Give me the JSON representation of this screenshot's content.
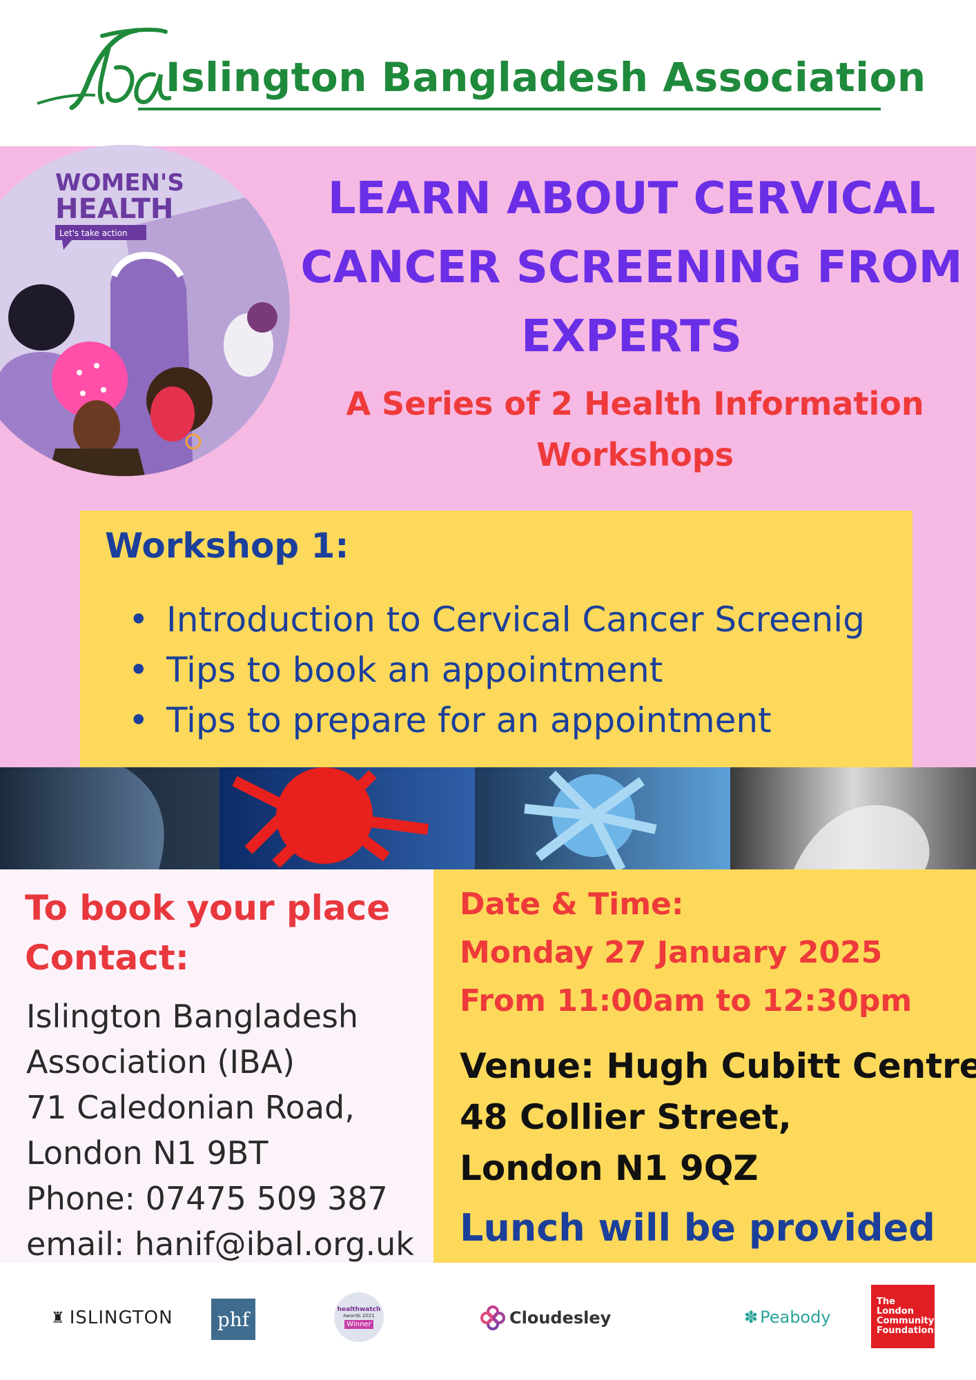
{
  "header": {
    "org_name": "Islington Bangladesh Association",
    "brand_color": "#1f8a3b"
  },
  "hero": {
    "image_text_line1": "WOMEN'S",
    "image_text_line2": "HEALTH",
    "image_tagline": "Let's take action",
    "headline_lines": [
      "LEARN ABOUT CERVICAL",
      "CANCER SCREENING FROM",
      "EXPERTS"
    ],
    "subheading_lines": [
      "A Series of 2 Health Information",
      "Workshops"
    ]
  },
  "workshop": {
    "title": "Workshop 1:",
    "items": [
      "Introduction to Cervical Cancer Screenig",
      "Tips to book an appointment",
      "Tips to prepare for an appointment"
    ]
  },
  "contact": {
    "heading_lines": [
      "To book your place",
      "Contact:"
    ],
    "lines": [
      "Islington Bangladesh",
      "Association (IBA)",
      "71 Caledonian Road,",
      "London  N1 9BT",
      "Phone: 07475 509 387",
      "email: hanif@ibal.org.uk"
    ]
  },
  "event": {
    "datetime_lines": [
      "Date & Time:",
      "Monday 27 January 2025",
      "From 11:00am to 12:30pm"
    ],
    "venue_lines": [
      "Venue: Hugh Cubitt Centre",
      "48 Collier Street,",
      "London N1 9QZ"
    ],
    "lunch": "Lunch will be provided"
  },
  "sponsors": {
    "islington": "ISLINGTON",
    "phf": "phf",
    "healthwatch": "healthwatch",
    "healthwatch_award": "Awards 2021",
    "healthwatch_winner": "Winner",
    "cloudesley": "Cloudesley",
    "peabody": "Peabody",
    "tlcf_lines": [
      "The London",
      "Community",
      "Foundation"
    ]
  },
  "colors": {
    "pink_band": "#f6b9e3",
    "yellow_panel": "#fcd95a",
    "headline_purple": "#6a2ee6",
    "accent_red": "#ee3a3a",
    "navy": "#1b3f9a"
  }
}
